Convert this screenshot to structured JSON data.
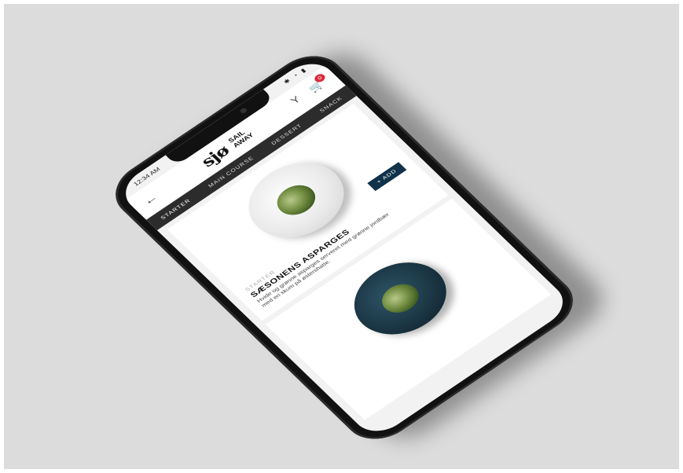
{
  "status": {
    "time": "12:34 AM"
  },
  "brand": {
    "mark": "sjø",
    "name_line1": "SAIL",
    "name_line2": "AWAY"
  },
  "cart": {
    "count": "0"
  },
  "tabs": [
    {
      "label": "STARTER"
    },
    {
      "label": "MAIN COURSE"
    },
    {
      "label": "DESSERT"
    },
    {
      "label": "SNACK"
    }
  ],
  "dish": {
    "category": "STARTER",
    "title": "SÆSONENS ASPARGES",
    "description": "Hvide og grønne asparges serveret med grønne jordbær med en skum på østershatte.",
    "add_label": "+ ADD"
  },
  "icons": {
    "back": "arrow-left-icon",
    "cocktail": "cocktail-icon",
    "cart": "cart-icon"
  },
  "colors": {
    "tab_bar": "#2c2c2c",
    "add_button": "#10324a",
    "badge": "#d92b3a"
  }
}
